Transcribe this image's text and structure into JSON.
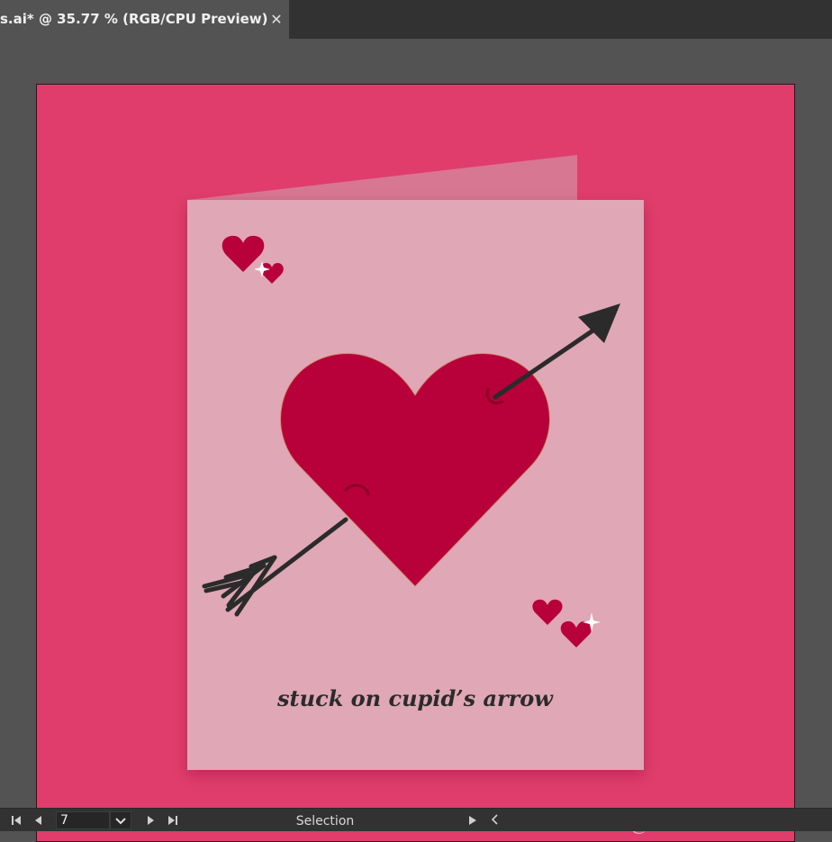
{
  "document_tab": {
    "title": "s.ai* @ 35.77 % (RGB/CPU Preview)",
    "close_glyph": "✕"
  },
  "artboard": {
    "background_color": "#e03d6c",
    "card_color": "#e0a7b6",
    "heart_color": "#b8003b",
    "arrow_color": "#2b2b2b",
    "card_caption": "stuck on cupid’s arrow",
    "watermark": "@dontmakelies"
  },
  "status_bar": {
    "artboard_number": "7",
    "tool_mode": "Selection",
    "icons": {
      "first": "first-artboard-icon",
      "prev": "previous-artboard-icon",
      "dropdown": "chevron-down-icon",
      "next": "next-artboard-icon",
      "last": "last-artboard-icon",
      "play": "play-icon",
      "collapse": "chevron-left-icon"
    }
  }
}
